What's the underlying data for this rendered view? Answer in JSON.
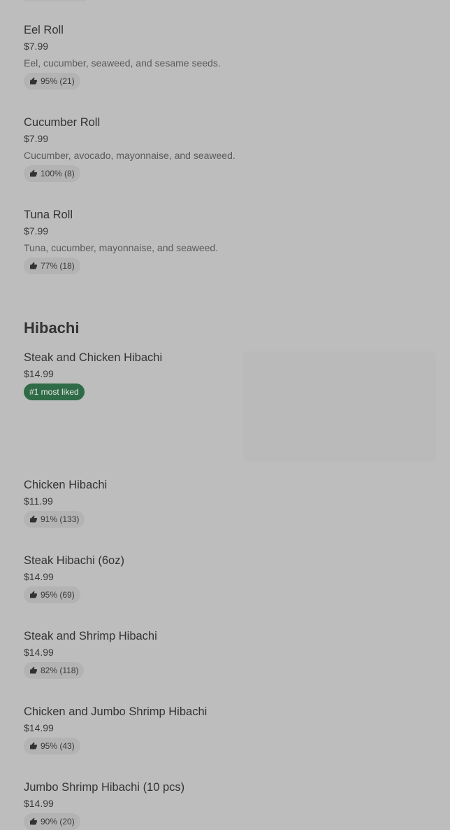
{
  "menu": {
    "items_top": [
      {
        "name": "Eel Roll",
        "price": "$7.99",
        "description": "Eel, cucumber, seaweed, and sesame seeds.",
        "rating": "95% (21)"
      },
      {
        "name": "Cucumber Roll",
        "price": "$7.99",
        "description": "Cucumber, avocado, mayonnaise, and seaweed.",
        "rating": "100% (8)"
      },
      {
        "name": "Tuna Roll",
        "price": "$7.99",
        "description": "Tuna, cucumber, mayonnaise, and seaweed.",
        "rating": "77% (18)"
      }
    ],
    "sections": [
      {
        "title": "Hibachi",
        "items": [
          {
            "name": "Steak and Chicken Hibachi",
            "price": "$14.99",
            "badge": "#1 most liked"
          },
          {
            "name": "Chicken Hibachi",
            "price": "$11.99",
            "rating": "91% (133)"
          },
          {
            "name": "Steak Hibachi (6oz)",
            "price": "$14.99",
            "rating": "95% (69)"
          },
          {
            "name": "Steak and Shrimp Hibachi",
            "price": "$14.99",
            "rating": "82% (118)"
          },
          {
            "name": "Chicken and Jumbo Shrimp Hibachi",
            "price": "$14.99",
            "rating": "95% (43)"
          },
          {
            "name": "Jumbo Shrimp Hibachi (10 pcs)",
            "price": "$14.99",
            "rating": "90% (20)"
          }
        ]
      }
    ],
    "icons": {
      "thumb": "thumbs-up-icon"
    }
  },
  "colors": {
    "background": "#bdbdbd",
    "most_liked_badge": "#2f6b46"
  }
}
